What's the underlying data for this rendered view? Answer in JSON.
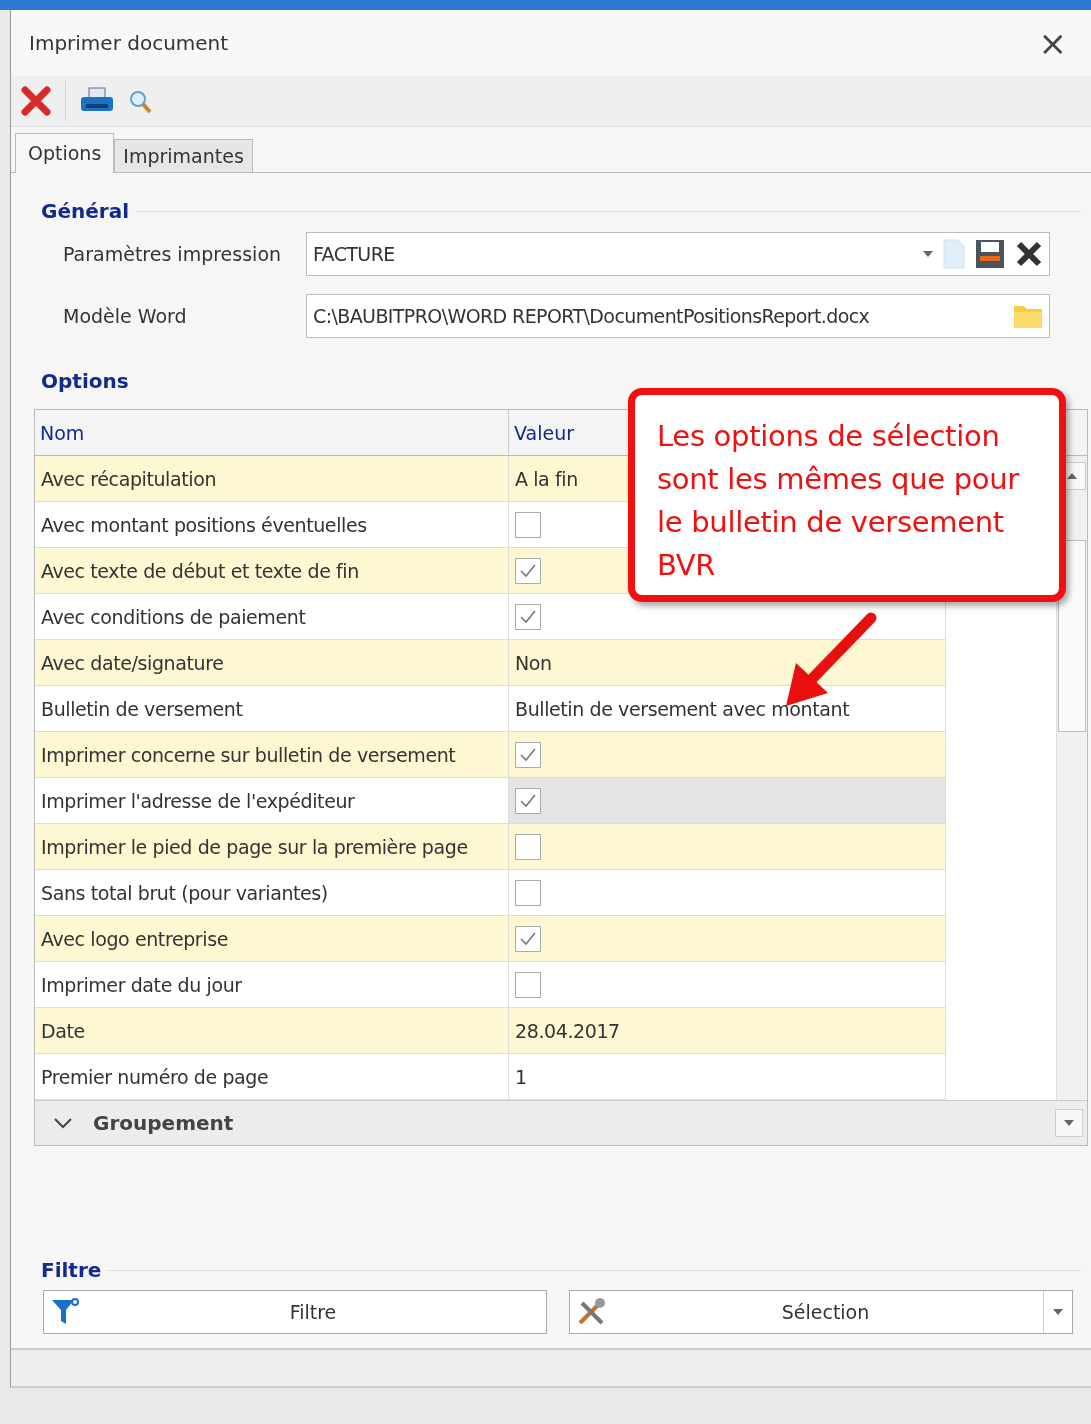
{
  "window": {
    "title": "Imprimer document",
    "close": "×"
  },
  "tabs": [
    {
      "label": "Options",
      "selected": true
    },
    {
      "label": "Imprimantes",
      "selected": false
    }
  ],
  "general": {
    "title": "Général",
    "fields": [
      {
        "label": "Paramètres impression",
        "value": "FACTURE",
        "kind": "combo"
      },
      {
        "label": "Modèle Word",
        "value": "C:\\BAUBITPRO\\WORD REPORT\\DocumentPositionsReport.docx",
        "kind": "path"
      }
    ]
  },
  "options": {
    "title": "Options",
    "columns": [
      "Nom",
      "Valeur"
    ],
    "rows": [
      {
        "name": "Avec récapitulation",
        "kind": "text",
        "value": "A la fin",
        "selected": false
      },
      {
        "name": "Avec montant positions éventuelles",
        "kind": "check",
        "checked": false,
        "selected": false
      },
      {
        "name": "Avec texte de début et texte de fin",
        "kind": "check",
        "checked": true,
        "selected": false
      },
      {
        "name": "Avec conditions de paiement",
        "kind": "check",
        "checked": true,
        "selected": false
      },
      {
        "name": "Avec date/signature",
        "kind": "text",
        "value": "Non",
        "selected": false
      },
      {
        "name": "Bulletin de versement",
        "kind": "text",
        "value": "Bulletin de versement avec montant",
        "selected": false
      },
      {
        "name": "Imprimer concerne sur bulletin de versement",
        "kind": "check",
        "checked": true,
        "selected": false
      },
      {
        "name": "Imprimer l'adresse de l'expéditeur",
        "kind": "check",
        "checked": true,
        "selected": true
      },
      {
        "name": "Imprimer le pied de page sur la première page",
        "kind": "check",
        "checked": false,
        "selected": false
      },
      {
        "name": "Sans total brut (pour variantes)",
        "kind": "check",
        "checked": false,
        "selected": false
      },
      {
        "name": "Avec logo entreprise",
        "kind": "check",
        "checked": true,
        "selected": false
      },
      {
        "name": "Imprimer date du jour",
        "kind": "check",
        "checked": false,
        "selected": false
      },
      {
        "name": "Date",
        "kind": "text",
        "value": "28.04.2017",
        "selected": false
      },
      {
        "name": "Premier numéro de page",
        "kind": "text",
        "value": "1",
        "selected": false
      }
    ],
    "group": {
      "label": "Groupement",
      "expanded": true
    }
  },
  "callout": {
    "text": "Les options de sélection sont les mêmes que pour le bulletin de versement BVR"
  },
  "filter": {
    "title": "Filtre",
    "buttons": [
      {
        "label": "Filtre",
        "kind": "filter"
      },
      {
        "label": "Sélection",
        "kind": "select"
      }
    ]
  }
}
